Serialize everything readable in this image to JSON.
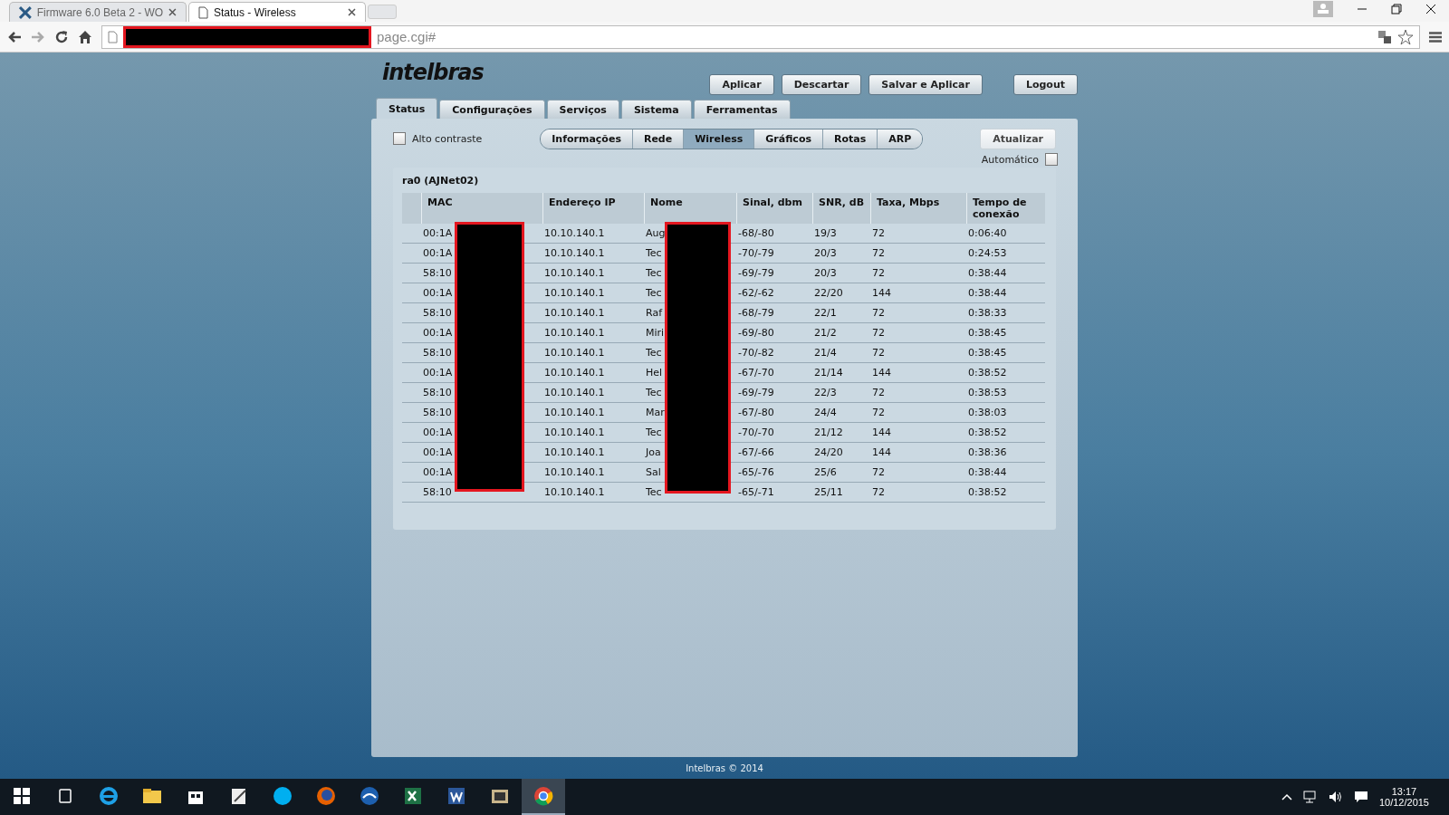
{
  "browser": {
    "tabs": [
      {
        "title": "Firmware 6.0 Beta 2 - WO",
        "selected": false
      },
      {
        "title": "Status - Wireless",
        "selected": true
      }
    ],
    "address": "page.cgi#"
  },
  "header": {
    "logo": "intelbras",
    "buttons": [
      "Aplicar",
      "Descartar",
      "Salvar e Aplicar"
    ],
    "logout": "Logout"
  },
  "nav_tabs": [
    {
      "label": "Status",
      "selected": true
    },
    {
      "label": "Configurações",
      "selected": false
    },
    {
      "label": "Serviços",
      "selected": false
    },
    {
      "label": "Sistema",
      "selected": false
    },
    {
      "label": "Ferramentas",
      "selected": false
    }
  ],
  "high_contrast": {
    "label": "Alto contraste",
    "checked": false
  },
  "sub_tabs": [
    {
      "label": "Informações",
      "selected": false
    },
    {
      "label": "Rede",
      "selected": false
    },
    {
      "label": "Wireless",
      "selected": true
    },
    {
      "label": "Gráficos",
      "selected": false
    },
    {
      "label": "Rotas",
      "selected": false
    },
    {
      "label": "ARP",
      "selected": false
    }
  ],
  "refresh_button": "Atualizar",
  "automatic": {
    "label": "Automático",
    "checked": false
  },
  "interface": {
    "title": "ra0 (AJNet02)",
    "columns": [
      "MAC",
      "Endereço IP",
      "Nome",
      "Sinal, dbm",
      "SNR, dB",
      "Taxa, Mbps",
      "Tempo de conexão"
    ],
    "rows": [
      [
        "00:1A",
        "10.10.140.1",
        "Aug",
        "-68/-80",
        "19/3",
        "72",
        "0:06:40"
      ],
      [
        "00:1A",
        "10.10.140.1",
        "Tec",
        "-70/-79",
        "20/3",
        "72",
        "0:24:53"
      ],
      [
        "58:10",
        "10.10.140.1",
        "Tec",
        "-69/-79",
        "20/3",
        "72",
        "0:38:44"
      ],
      [
        "00:1A",
        "10.10.140.1",
        "Tec",
        "-62/-62",
        "22/20",
        "144",
        "0:38:44"
      ],
      [
        "58:10",
        "10.10.140.1",
        "Raf",
        "-68/-79",
        "22/1",
        "72",
        "0:38:33"
      ],
      [
        "00:1A",
        "10.10.140.1",
        "Miri",
        "-69/-80",
        "21/2",
        "72",
        "0:38:45"
      ],
      [
        "58:10",
        "10.10.140.1",
        "Tec",
        "-70/-82",
        "21/4",
        "72",
        "0:38:45"
      ],
      [
        "00:1A",
        "10.10.140.1",
        "Hel",
        "-67/-70",
        "21/14",
        "144",
        "0:38:52"
      ],
      [
        "58:10",
        "10.10.140.1",
        "Tec",
        "-69/-79",
        "22/3",
        "72",
        "0:38:53"
      ],
      [
        "58:10",
        "10.10.140.1",
        "Mar",
        "-67/-80",
        "24/4",
        "72",
        "0:38:03"
      ],
      [
        "00:1A",
        "10.10.140.1",
        "Tec",
        "-70/-70",
        "21/12",
        "144",
        "0:38:52"
      ],
      [
        "00:1A",
        "10.10.140.1",
        "Joa",
        "-67/-66",
        "24/20",
        "144",
        "0:38:36"
      ],
      [
        "00:1A",
        "10.10.140.1",
        "Sal",
        "-65/-76",
        "25/6",
        "72",
        "0:38:44"
      ],
      [
        "58:10",
        "10.10.140.1",
        "Tec",
        "-65/-71",
        "25/11",
        "72",
        "0:38:52"
      ]
    ]
  },
  "footer": "Intelbras © 2014",
  "taskbar": {
    "apps": [
      {
        "selected": false
      },
      {
        "selected": false
      },
      {
        "selected": false
      },
      {
        "selected": false
      },
      {
        "selected": false
      },
      {
        "selected": false
      },
      {
        "selected": false
      },
      {
        "selected": false
      },
      {
        "selected": false
      },
      {
        "selected": false
      },
      {
        "selected": false
      },
      {
        "selected": true
      }
    ],
    "time": "13:17",
    "date": "10/12/2015"
  }
}
